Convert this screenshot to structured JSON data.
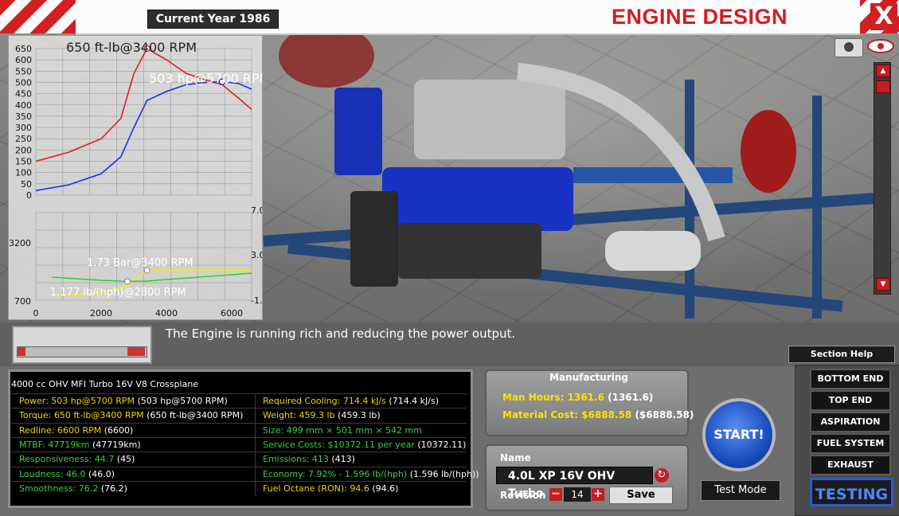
{
  "header": {
    "current_year": "Current Year 1986",
    "title": "ENGINE DESIGN",
    "close": "X"
  },
  "graph": {
    "torque_label": "650 ft-lb@3400 RPM",
    "power_label": "503 hp@5700 RPM",
    "boost_label": "1.73 Bar@3400 RPM",
    "economy_label": "1.177 lb/(hph)@2800 RPM",
    "top_y_ticks": [
      "650",
      "600",
      "550",
      "500",
      "450",
      "400",
      "350",
      "300",
      "250",
      "200",
      "150",
      "100",
      "50",
      "0"
    ],
    "bottom_left_ticks": [
      "3200",
      "700"
    ],
    "bottom_right_ticks": [
      "7.0",
      "3.0",
      "-1.0"
    ],
    "x_ticks": [
      "0",
      "2000",
      "4000",
      "6000"
    ],
    "colors": {
      "torque": "#e01d1d",
      "power": "#1f2fe0",
      "boost": "#f4f000",
      "economy": "#28d028"
    }
  },
  "chart_data": [
    {
      "type": "line",
      "x": [
        0,
        1000,
        2000,
        2600,
        3000,
        3400,
        4000,
        4600,
        5200,
        5700,
        6200,
        6600
      ],
      "series": [
        {
          "name": "Torque",
          "values": [
            150,
            190,
            250,
            340,
            540,
            650,
            600,
            540,
            510,
            490,
            430,
            380
          ]
        },
        {
          "name": "Power",
          "values": [
            20,
            45,
            95,
            170,
            300,
            420,
            460,
            490,
            500,
            503,
            495,
            470
          ]
        }
      ],
      "ylim": [
        0,
        650
      ],
      "xlim": [
        0,
        6600
      ]
    },
    {
      "type": "line",
      "x": [
        500,
        1200,
        2000,
        2800,
        3400,
        4000,
        5000,
        6000,
        6600
      ],
      "series": [
        {
          "name": "Boost",
          "values": [
            -0.6,
            -0.5,
            -0.3,
            0.3,
            1.73,
            1.73,
            1.73,
            1.73,
            1.73
          ]
        },
        {
          "name": "Economy",
          "values": [
            1.45,
            1.35,
            1.25,
            1.177,
            1.2,
            1.3,
            1.45,
            1.6,
            1.7
          ]
        }
      ]
    }
  ],
  "message": "The Engine is running rich and reducing the power output.",
  "stats": {
    "title": "4000 cc OHV MFI Turbo 16V V8 Crossplane",
    "rows": [
      {
        "left_label": "Power: 503 hp@5700 RPM",
        "left_paren": " (503 hp@5700 RPM)",
        "left_color": "y",
        "right_label": "Required Cooling: 714.4 kJ/s",
        "right_paren": " (714.4 kJ/s)",
        "right_color": "y"
      },
      {
        "left_label": "Torque: 650 ft-lb@3400 RPM",
        "left_paren": " (650 ft-lb@3400 RPM)",
        "left_color": "y",
        "right_label": "Weight: 459.3 lb",
        "right_paren": " (459.3 lb)",
        "right_color": "y"
      },
      {
        "left_label": "Redline: 6600 RPM",
        "left_paren": " (6600)",
        "left_color": "y",
        "right_label": "Size: 499 mm × 501 mm × 542 mm",
        "right_paren": "",
        "right_color": "g"
      },
      {
        "left_label": "MTBF: 47719km",
        "left_paren": " (47719km)",
        "left_color": "g",
        "right_label": "Service Costs: $10372.11 per year",
        "right_paren": " (10372.11)",
        "right_color": "g"
      },
      {
        "left_label": "Responsiveness: 44.7",
        "left_paren": " (45)",
        "left_color": "g",
        "right_label": "Emissions: 413",
        "right_paren": " (413)",
        "right_color": "g"
      },
      {
        "left_label": "Loudness: 46.0",
        "left_paren": " (46.0)",
        "left_color": "g",
        "right_label": "Economy: 7.92% - 1.596 lb/(hph)",
        "right_paren": " (1.596 lb/(hph))",
        "right_color": "g"
      },
      {
        "left_label": "Smoothness: 76.2",
        "left_paren": " (76.2)",
        "left_color": "g",
        "right_label": "Fuel Octane (RON): 94.6",
        "right_paren": " (94.6)",
        "right_color": "y"
      }
    ]
  },
  "manufacturing": {
    "title": "Manufacturing",
    "man_hours_label": "Man Hours: 1361.6",
    "man_hours_paren": "(1361.6)",
    "material_cost_label": "Material Cost: $6888.58",
    "material_cost_paren": "($6888.58)"
  },
  "name_panel": {
    "name_label": "Name",
    "name_value": "4.0L XP 16V OHV Turbo",
    "revision_label": "Revision",
    "revision_value": "14",
    "minus": "−",
    "plus": "+",
    "save": "Save"
  },
  "actions": {
    "start": "START!",
    "test_mode": "Test Mode"
  },
  "section_menu": {
    "help": "Section Help",
    "items": [
      "BOTTOM END",
      "TOP END",
      "ASPIRATION",
      "FUEL SYSTEM",
      "EXHAUST"
    ],
    "active": "TESTING"
  }
}
